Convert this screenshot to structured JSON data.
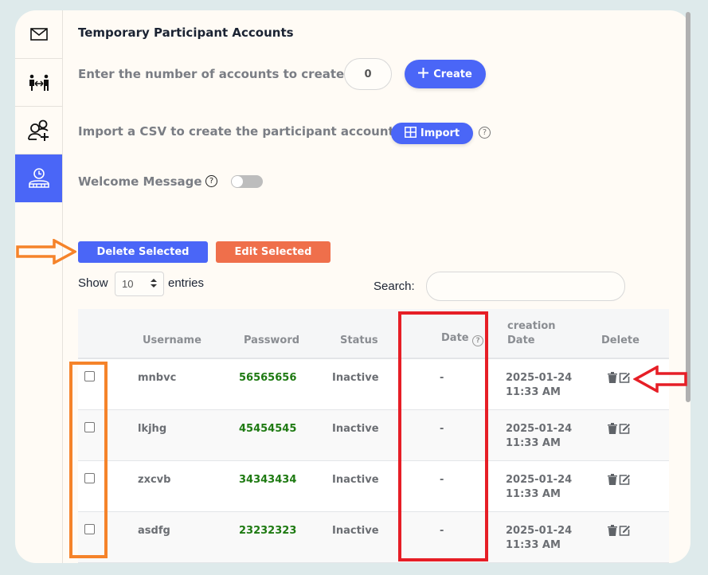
{
  "sidebar": {
    "items": [
      {
        "icon": "mail-icon",
        "label": "Messages",
        "active": false
      },
      {
        "icon": "exchange-people-icon",
        "label": "Exchange",
        "active": false
      },
      {
        "icon": "add-user-icon",
        "label": "Add participants",
        "active": false
      },
      {
        "icon": "temporary-accounts-icon",
        "label": "Temporary accounts",
        "active": true
      }
    ]
  },
  "page": {
    "title": "Temporary Participant Accounts",
    "create_label": "Enter the number of accounts to create",
    "create_count": "0",
    "create_button": "Create",
    "import_label": "Import a CSV to create the participant account.",
    "import_button": "Import",
    "welcome_label": "Welcome Message",
    "welcome_enabled": false,
    "help_glyph": "?"
  },
  "actions": {
    "delete_selected": "Delete Selected",
    "edit_selected": "Edit Selected"
  },
  "table_controls": {
    "show_label": "Show",
    "entries_value": "10",
    "entries_label": "entries",
    "search_label": "Search:",
    "search_value": "",
    "search_placeholder": ""
  },
  "table": {
    "headers": {
      "select": "",
      "username": "Username",
      "password": "Password",
      "status": "Status",
      "date": "Date",
      "creation_date_line1": "creation",
      "creation_date_line2": "Date",
      "delete": "Delete"
    },
    "rows": [
      {
        "username": "mnbvc",
        "password": "56565656",
        "status": "Inactive",
        "date": "-",
        "created_date": "2025-01-24",
        "created_time": "11:33 AM"
      },
      {
        "username": "lkjhg",
        "password": "45454545",
        "status": "Inactive",
        "date": "-",
        "created_date": "2025-01-24",
        "created_time": "11:33 AM"
      },
      {
        "username": "zxcvb",
        "password": "34343434",
        "status": "Inactive",
        "date": "-",
        "created_date": "2025-01-24",
        "created_time": "11:33 AM"
      },
      {
        "username": "asdfg",
        "password": "23232323",
        "status": "Inactive",
        "date": "-",
        "created_date": "2025-01-24",
        "created_time": "11:33 AM"
      }
    ]
  },
  "colors": {
    "primary": "#4a66f7",
    "edit": "#ef6f4b",
    "password_green": "#1e7a12",
    "annotation_orange": "#f5832a",
    "annotation_red": "#e61e26"
  }
}
